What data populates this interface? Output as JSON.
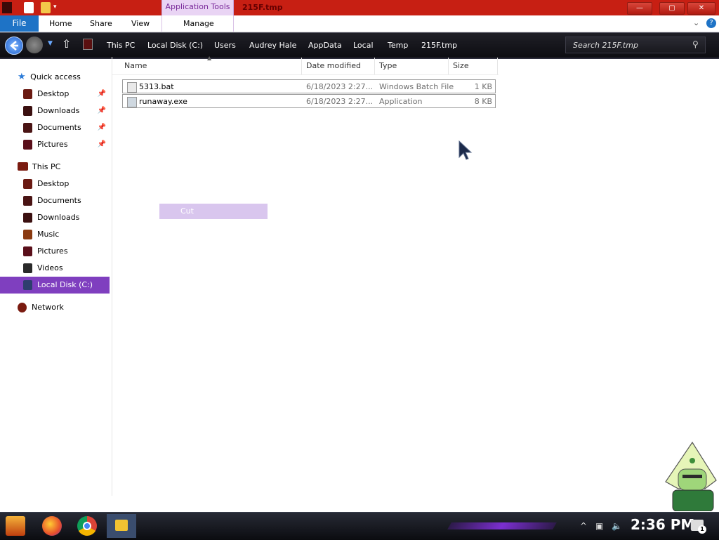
{
  "window": {
    "title": "215F.tmp",
    "context_tab": "Application Tools",
    "controls": {
      "minimize": "—",
      "maximize": "▢",
      "close": "✕"
    }
  },
  "ribbon": {
    "tabs": [
      "File",
      "Home",
      "Share",
      "View",
      "Manage"
    ],
    "help": "?"
  },
  "address": {
    "breadcrumbs": [
      "This PC",
      "Local Disk (C:)",
      "Users",
      "Audrey Hale",
      "AppData",
      "Local",
      "Temp",
      "215F.tmp"
    ],
    "search_placeholder": "Search 215F.tmp"
  },
  "sidebar": {
    "quick_access": {
      "label": "Quick access",
      "items": [
        "Desktop",
        "Downloads",
        "Documents",
        "Pictures"
      ]
    },
    "this_pc": {
      "label": "This PC",
      "items": [
        "Desktop",
        "Documents",
        "Downloads",
        "Music",
        "Pictures",
        "Videos",
        "Local Disk (C:)"
      ]
    },
    "network": {
      "label": "Network"
    }
  },
  "columns": {
    "name": "Name",
    "date": "Date modified",
    "type": "Type",
    "size": "Size"
  },
  "files": [
    {
      "name": "5313.bat",
      "date": "6/18/2023 2:27...",
      "type": "Windows Batch File",
      "size": "1 KB"
    },
    {
      "name": "runaway.exe",
      "date": "6/18/2023 2:27...",
      "type": "Application",
      "size": "8 KB"
    }
  ],
  "context_menu": {
    "cut_label": "Cut"
  },
  "taskbar": {
    "clock": "2:36 PM",
    "notification_count": "1",
    "apps": [
      "start-icon",
      "firefox-icon",
      "chrome-icon",
      "file-explorer-icon"
    ]
  },
  "colors": {
    "titlebar": "#c71f13",
    "file_tab": "#1e73c6",
    "selection": "#7f3fbf",
    "context_highlight": "#d9c6ee"
  }
}
